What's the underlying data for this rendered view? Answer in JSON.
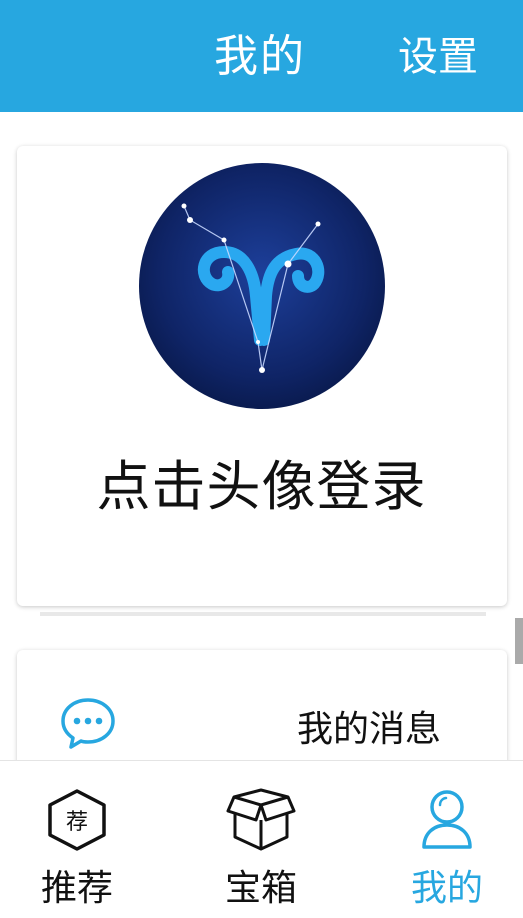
{
  "header": {
    "title": "我的",
    "settings_label": "设置"
  },
  "profile": {
    "login_prompt": "点击头像登录"
  },
  "menu": {
    "items": [
      {
        "label": "我的消息",
        "icon": "message-bubble-icon"
      }
    ]
  },
  "tabs": [
    {
      "label": "推荐",
      "icon": "hexagon-recommend-icon",
      "badge_char": "荐",
      "active": false
    },
    {
      "label": "宝箱",
      "icon": "box-icon",
      "active": false
    },
    {
      "label": "我的",
      "icon": "user-icon",
      "active": true
    }
  ],
  "colors": {
    "accent": "#27a7e0",
    "avatar_bg": "#0d1f5a",
    "text": "#111111"
  }
}
